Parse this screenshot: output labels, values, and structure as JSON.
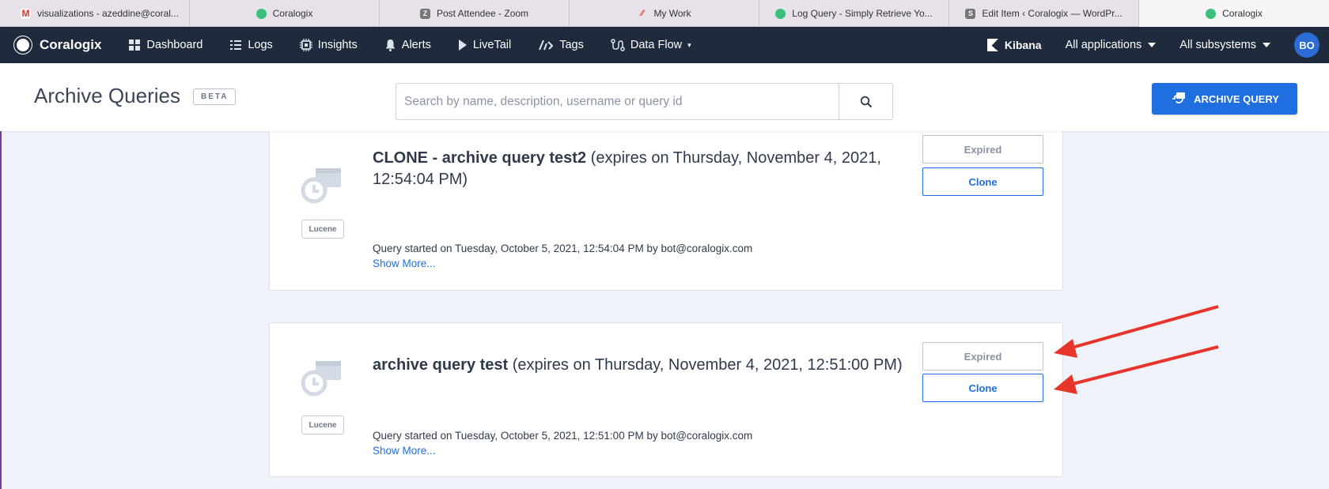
{
  "browser": {
    "tabs": [
      {
        "title": "visualizations - azeddine@coral...",
        "icon": "gmail-icon"
      },
      {
        "title": "Coralogix",
        "icon": "coralogix-icon"
      },
      {
        "title": "Post Attendee - Zoom",
        "icon": "zoom-icon"
      },
      {
        "title": "My Work",
        "icon": "monday-icon"
      },
      {
        "title": "Log Query - Simply Retrieve Yo...",
        "icon": "coralogix-icon"
      },
      {
        "title": "Edit Item ‹ Coralogix — WordPr...",
        "icon": "wordpress-icon"
      },
      {
        "title": "Coralogix",
        "icon": "coralogix-icon"
      }
    ]
  },
  "navbar": {
    "brand": "Coralogix",
    "items": [
      {
        "label": "Dashboard",
        "icon": "dashboard-icon"
      },
      {
        "label": "Logs",
        "icon": "logs-icon"
      },
      {
        "label": "Insights",
        "icon": "insights-icon"
      },
      {
        "label": "Alerts",
        "icon": "bell-icon"
      },
      {
        "label": "LiveTail",
        "icon": "play-icon"
      },
      {
        "label": "Tags",
        "icon": "tags-icon"
      },
      {
        "label": "Data Flow",
        "icon": "data-flow-icon"
      }
    ],
    "kibana": "Kibana",
    "applications": "All applications",
    "subsystems": "All subsystems",
    "avatar": "BO"
  },
  "header": {
    "title": "Archive Queries",
    "badge": "BETA",
    "search_placeholder": "Search by name, description, username or query id",
    "archive_button": "ARCHIVE QUERY"
  },
  "queries": [
    {
      "name": "CLONE - archive query test2",
      "expires": "(expires on Thursday, November 4, 2021, 12:54:04 PM)",
      "language": "Lucene",
      "started": "Query started on Tuesday, October 5, 2021, 12:54:04 PM by bot@coralogix.com",
      "show_more": "Show More...",
      "status": "Expired",
      "clone": "Clone"
    },
    {
      "name": "archive query test",
      "expires": "(expires on Thursday, November 4, 2021, 12:51:00 PM)",
      "language": "Lucene",
      "started": "Query started on Tuesday, October 5, 2021, 12:51:00 PM by bot@coralogix.com",
      "show_more": "Show More...",
      "status": "Expired",
      "clone": "Clone"
    }
  ],
  "colors": {
    "navbar": "#1f2a3c",
    "accent": "#1f6fe0",
    "annotation": "#e8352b"
  }
}
